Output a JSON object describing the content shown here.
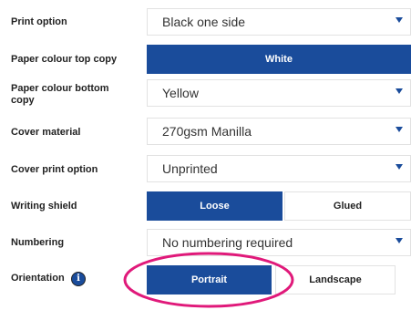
{
  "form": {
    "print_option": {
      "label": "Print option",
      "value": "Black one side"
    },
    "paper_top": {
      "label": "Paper colour top copy",
      "value": "White"
    },
    "paper_bottom": {
      "label": "Paper colour bottom copy",
      "value": "Yellow"
    },
    "cover_material": {
      "label": "Cover material",
      "value": "270gsm Manilla"
    },
    "cover_print": {
      "label": "Cover print option",
      "value": "Unprinted"
    },
    "writing_shield": {
      "label": "Writing shield",
      "options": [
        "Loose",
        "Glued"
      ],
      "selected": "Loose"
    },
    "numbering": {
      "label": "Numbering",
      "value": "No numbering required"
    },
    "orientation": {
      "label": "Orientation",
      "options": [
        "Portrait",
        "Landscape"
      ],
      "selected": "Portrait"
    }
  },
  "colors": {
    "accent": "#1a4c9b",
    "highlight_ring": "#e0197a",
    "border": "#e2e2e2"
  },
  "icons": {
    "dropdown": "chevron-down-icon",
    "info": "info-icon"
  }
}
